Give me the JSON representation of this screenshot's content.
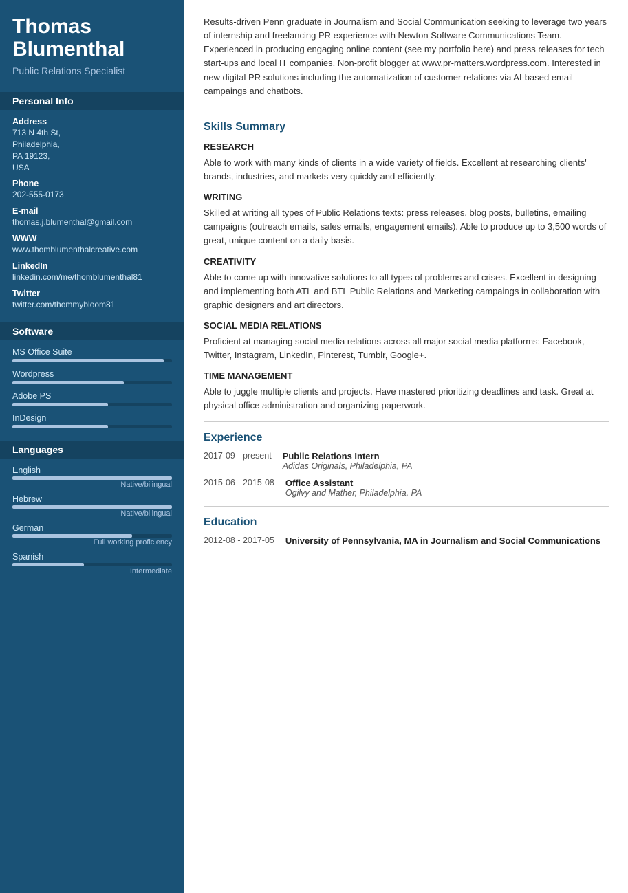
{
  "sidebar": {
    "name": "Thomas Blumenthal",
    "title": "Public Relations Specialist",
    "sections": {
      "personal_info": {
        "label": "Personal Info",
        "fields": [
          {
            "label": "Address",
            "value": "713 N 4th St,\nPhiladelphia,\nPA 19123,\nUSA"
          },
          {
            "label": "Phone",
            "value": "202-555-0173"
          },
          {
            "label": "E-mail",
            "value": "thomas.j.blumenthal@gmail.com"
          },
          {
            "label": "WWW",
            "value": "www.thomblumenthalcreative.com"
          },
          {
            "label": "LinkedIn",
            "value": "linkedin.com/me/thomblumenthal81"
          },
          {
            "label": "Twitter",
            "value": "twitter.com/thommybloom81"
          }
        ]
      },
      "software": {
        "label": "Software",
        "items": [
          {
            "name": "MS Office Suite",
            "percent": 95
          },
          {
            "name": "Wordpress",
            "percent": 70
          },
          {
            "name": "Adobe PS",
            "percent": 60
          },
          {
            "name": "InDesign",
            "percent": 60
          }
        ]
      },
      "languages": {
        "label": "Languages",
        "items": [
          {
            "name": "English",
            "percent": 100,
            "level": "Native/bilingual"
          },
          {
            "name": "Hebrew",
            "percent": 100,
            "level": "Native/bilingual"
          },
          {
            "name": "German",
            "percent": 75,
            "level": "Full working proficiency"
          },
          {
            "name": "Spanish",
            "percent": 45,
            "level": "Intermediate"
          }
        ]
      }
    }
  },
  "main": {
    "summary": "Results-driven Penn graduate in Journalism and Social Communication seeking to leverage two years of internship and freelancing PR experience with Newton Software Communications Team. Experienced in producing engaging online content (see my portfolio here) and press releases for tech start-ups and local IT companies. Non-profit blogger at www.pr-matters.wordpress.com. Interested in new digital PR solutions including the automatization of customer relations via AI-based email campaings and chatbots.",
    "skills_summary_label": "Skills Summary",
    "skills": [
      {
        "title": "RESEARCH",
        "desc": "Able to work with many kinds of clients in a wide variety of fields. Excellent at researching clients' brands, industries, and markets very quickly and efficiently."
      },
      {
        "title": "WRITING",
        "desc": "Skilled at writing all types of Public Relations texts: press releases, blog posts, bulletins, emailing campaigns (outreach emails, sales emails, engagement emails). Able to produce up to 3,500 words of great, unique content on a daily basis."
      },
      {
        "title": "CREATIVITY",
        "desc": "Able to come up with innovative solutions to all types of problems and crises. Excellent in designing and implementing both ATL and BTL Public Relations and Marketing campaings in collaboration with graphic designers and art directors."
      },
      {
        "title": "SOCIAL MEDIA RELATIONS",
        "desc": "Proficient at managing social media relations across all major social media platforms: Facebook, Twitter, Instagram, LinkedIn, Pinterest, Tumblr, Google+."
      },
      {
        "title": "TIME MANAGEMENT",
        "desc": "Able to juggle multiple clients and projects. Have mastered prioritizing deadlines and task. Great at physical office administration and organizing paperwork."
      }
    ],
    "experience_label": "Experience",
    "experience": [
      {
        "date": "2017-09 - present",
        "title": "Public Relations Intern",
        "company": "Adidas Originals, Philadelphia, PA"
      },
      {
        "date": "2015-06 - 2015-08",
        "title": "Office Assistant",
        "company": "Ogilvy and Mather, Philadelphia, PA"
      }
    ],
    "education_label": "Education",
    "education": [
      {
        "date": "2012-08 - 2017-05",
        "title": "University of Pennsylvania, MA in Journalism and Social Communications"
      }
    ]
  }
}
